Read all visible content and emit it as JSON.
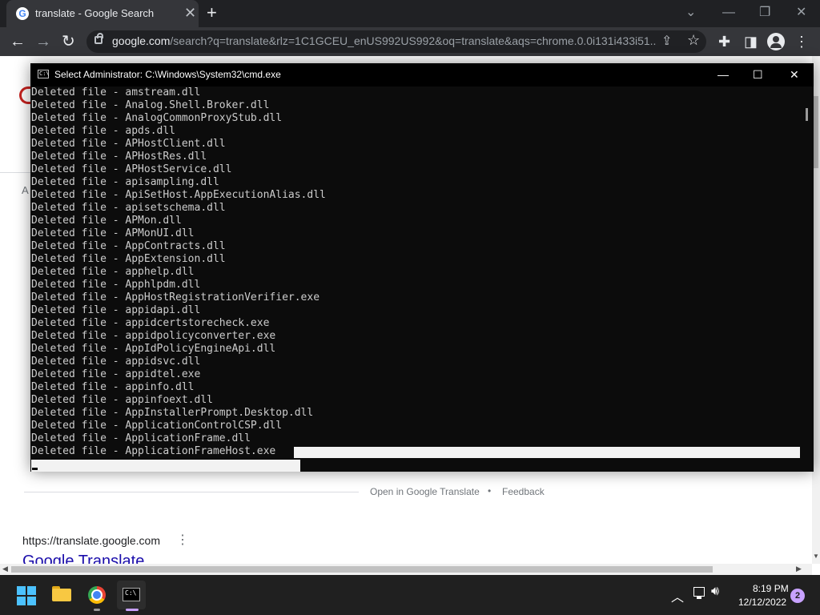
{
  "browser": {
    "tab_title": "translate - Google Search",
    "tab_favicon": "G",
    "tab_close_icon": "✕",
    "new_tab_icon": "+",
    "url_domain": "google.com",
    "url_rest": "/search?q=translate&rlz=1C1GCEU_enUS992US992&oq=translate&aqs=chrome.0.0i131i433i51..."
  },
  "page": {
    "section_letter": "A",
    "open_in_translate": "Open in Google Translate",
    "bullet": "•",
    "feedback": "Feedback",
    "result_url": "https://translate.google.com",
    "result_title": "Google Translate"
  },
  "cmd": {
    "title": "Select Administrator:  C:\\Windows\\System32\\cmd.exe",
    "icon_text": "C:\\",
    "lines": [
      "Deleted file - amstream.dll",
      "Deleted file - Analog.Shell.Broker.dll",
      "Deleted file - AnalogCommonProxyStub.dll",
      "Deleted file - apds.dll",
      "Deleted file - APHostClient.dll",
      "Deleted file - APHostRes.dll",
      "Deleted file - APHostService.dll",
      "Deleted file - apisampling.dll",
      "Deleted file - ApiSetHost.AppExecutionAlias.dll",
      "Deleted file - apisetschema.dll",
      "Deleted file - APMon.dll",
      "Deleted file - APMonUI.dll",
      "Deleted file - AppContracts.dll",
      "Deleted file - AppExtension.dll",
      "Deleted file - apphelp.dll",
      "Deleted file - Apphlpdm.dll",
      "Deleted file - AppHostRegistrationVerifier.exe",
      "Deleted file - appidapi.dll",
      "Deleted file - appidcertstorecheck.exe",
      "Deleted file - appidpolicyconverter.exe",
      "Deleted file - AppIdPolicyEngineApi.dll",
      "Deleted file - appidsvc.dll",
      "Deleted file - appidtel.exe",
      "Deleted file - appinfo.dll",
      "Deleted file - appinfoext.dll",
      "Deleted file - AppInstallerPrompt.Desktop.dll",
      "Deleted file - ApplicationControlCSP.dll",
      "Deleted file - ApplicationFrame.dll",
      "Deleted file - ApplicationFrameHost.exe"
    ]
  },
  "taskbar": {
    "clock_time": "8:19 PM",
    "clock_date": "12/12/2022",
    "notification_count": "2",
    "cmd_icon_text": "C:\\",
    "accent": "#4cc2ff"
  }
}
